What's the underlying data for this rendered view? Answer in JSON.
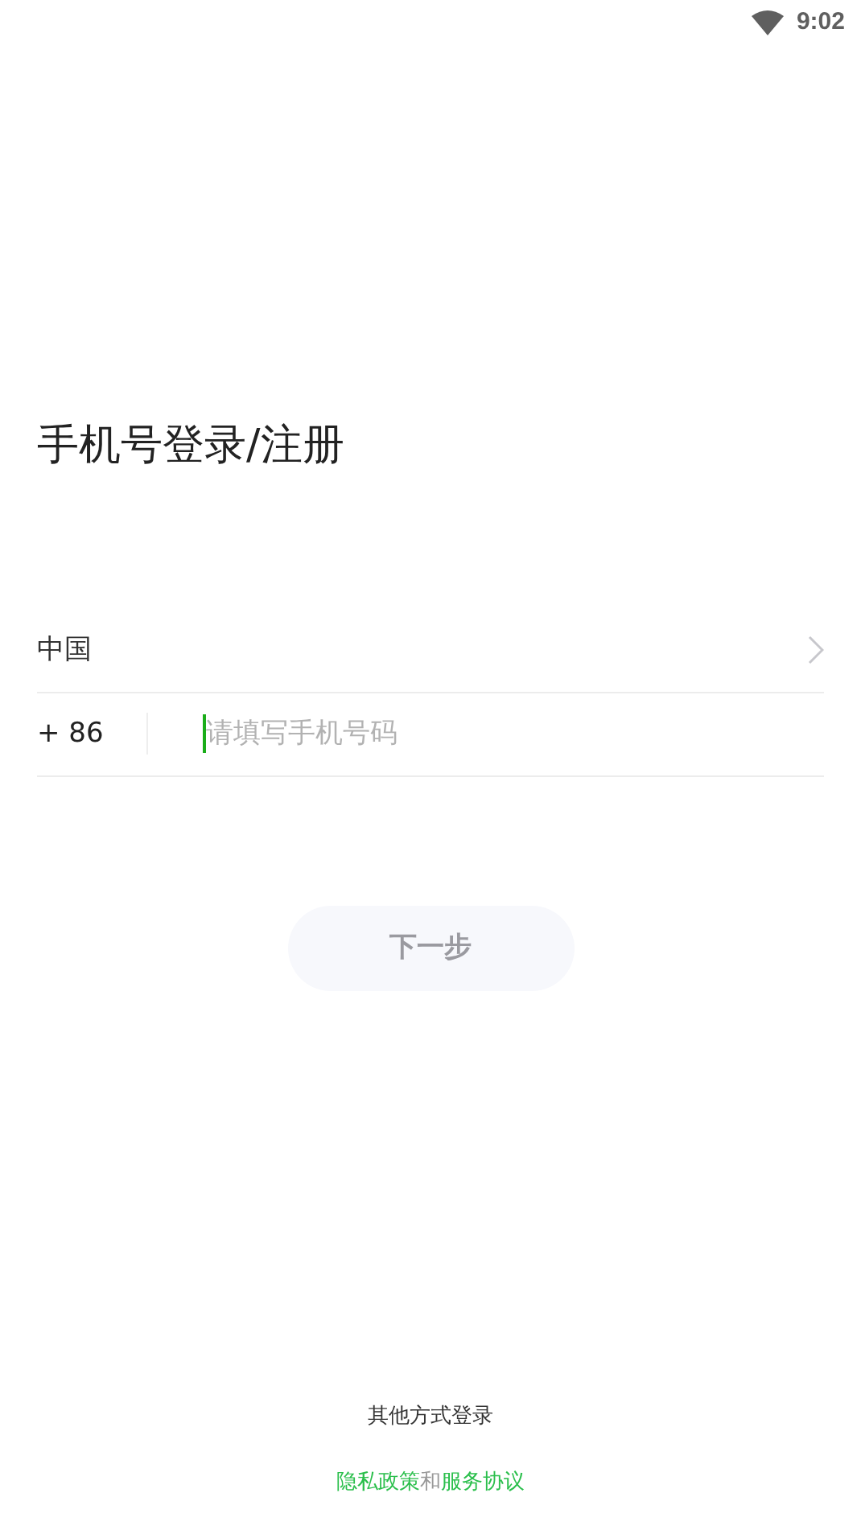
{
  "status_bar": {
    "time": "9:02"
  },
  "title": "手机号登录/注册",
  "country": {
    "name": "中国"
  },
  "phone": {
    "code": "+ 86",
    "placeholder": "请填写手机号码",
    "focused": true
  },
  "next_button": {
    "label": "下一步",
    "disabled": true
  },
  "other_login": "其他方式登录",
  "agreement": [
    {
      "kind": "link",
      "text": "隐私政策"
    },
    {
      "kind": "text",
      "text": "和"
    },
    {
      "kind": "link",
      "text": "服务协议"
    }
  ]
}
